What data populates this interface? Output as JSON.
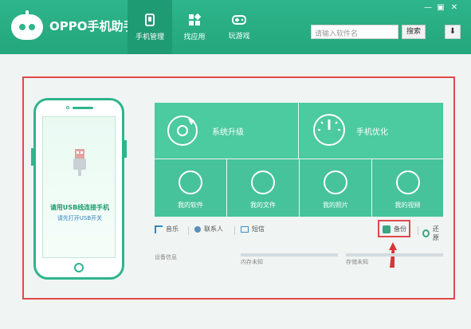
{
  "app": {
    "title": "OPPO手机助手"
  },
  "nav": [
    {
      "label": "手机管理",
      "icon": "phone-manage-icon"
    },
    {
      "label": "找应用",
      "icon": "apps-grid-icon"
    },
    {
      "label": "玩游戏",
      "icon": "gamepad-icon"
    }
  ],
  "search": {
    "placeholder": "请输入软件名",
    "button": "搜索"
  },
  "download": {
    "label": "⬇"
  },
  "window": {
    "minimize": "—",
    "restore": "▣",
    "close": "✕"
  },
  "phone": {
    "connect_text": "请用USB线连接手机",
    "sub_text": "请先打开USB开关"
  },
  "tiles": {
    "system_upgrade": "系统升级",
    "optimize": "手机优化",
    "small": [
      "我的软件",
      "我的文件",
      "我的照片",
      "我的视频"
    ]
  },
  "actions": [
    "音乐",
    "联系人",
    "短信",
    "备份",
    "还原"
  ],
  "status": {
    "device_info": "设备信息",
    "internal": "内存未知",
    "storage": "存储未知"
  },
  "colors": {
    "brand": "#2fb58b",
    "annotation": "#e04a4a"
  }
}
